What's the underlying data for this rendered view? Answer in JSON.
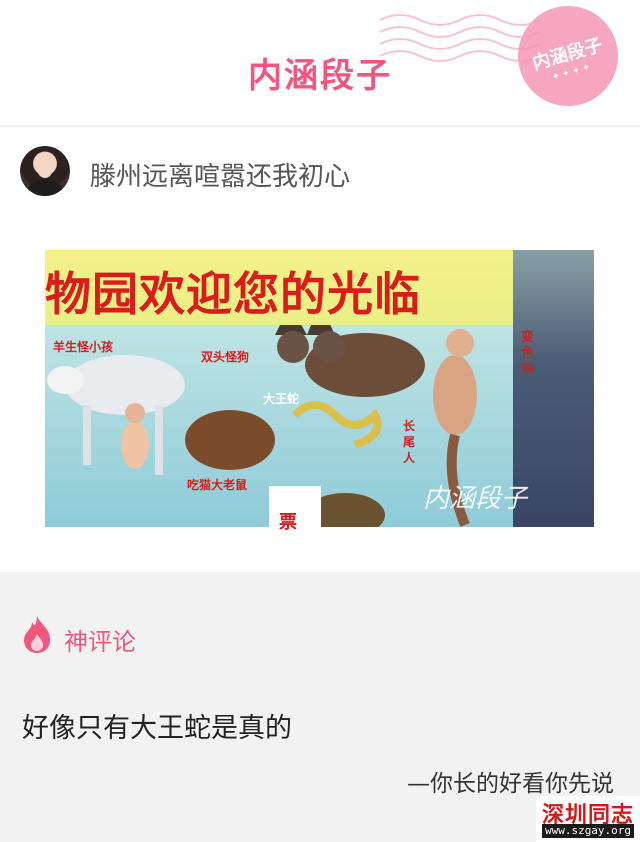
{
  "header": {
    "title": "内涵段子",
    "stamp_text": "内涵段子"
  },
  "post": {
    "username": "滕州远离喧嚣还我初心"
  },
  "photo": {
    "banner": "物园欢迎您的光临",
    "labels": {
      "sheep_child": "羊生怪小孩",
      "two_head_dog": "双头怪狗",
      "big_snake": "大王蛇",
      "long_tail": "长尾人",
      "cat_rat": "吃猫大老鼠",
      "right_bird": "变色鸡",
      "sign": "票"
    },
    "watermark": "内涵段子"
  },
  "comments": {
    "section_title": "神评论",
    "text": "好像只有大王蛇是真的",
    "author": "—你长的好看你先说"
  },
  "site": {
    "name": "深圳同志",
    "url": "www.szgay.org"
  },
  "colors": {
    "accent": "#f0577e",
    "background_comments": "#f2f2f2"
  }
}
